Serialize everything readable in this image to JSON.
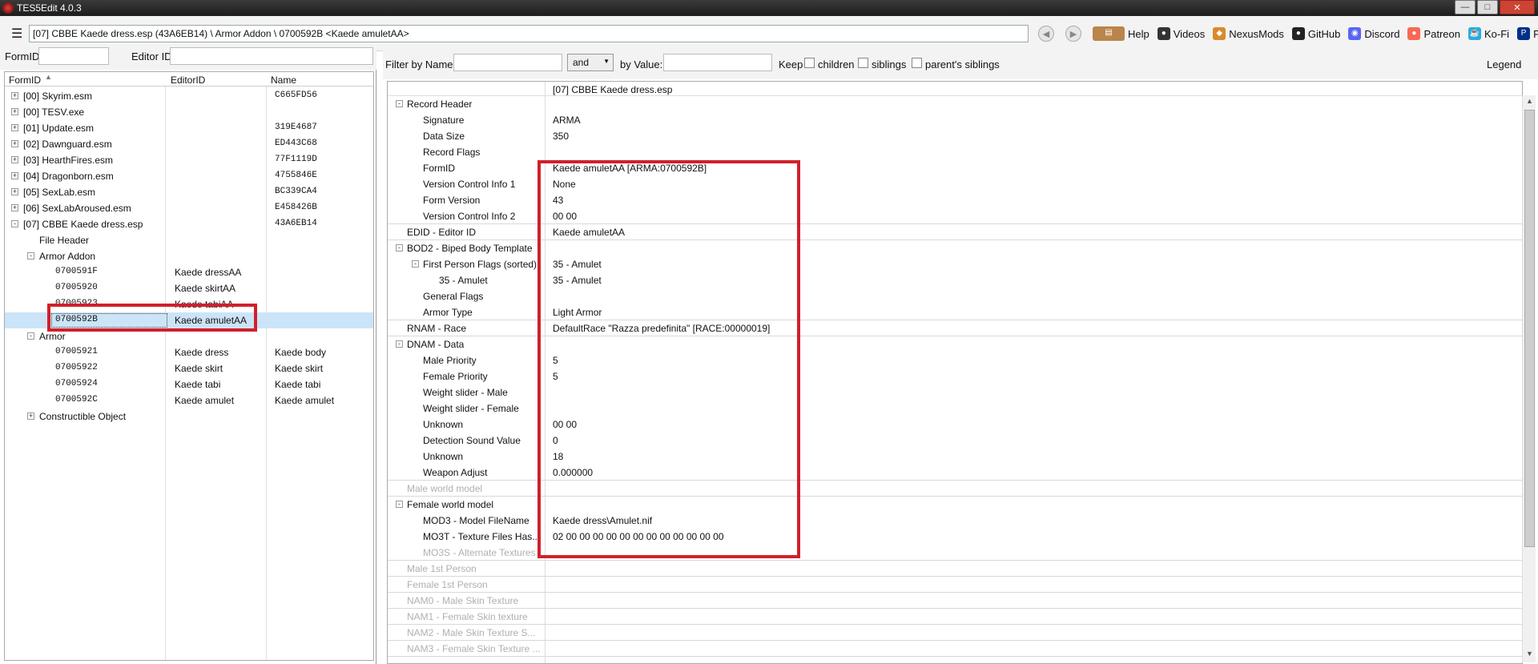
{
  "window": {
    "title": "TES5Edit 4.0.3"
  },
  "toolbar": {
    "path": "[07] CBBE Kaede dress.esp (43A6EB14) \\ Armor Addon \\ 0700592B <Kaede amuletAA>",
    "links": [
      {
        "label": "Help",
        "icon": "book-icon"
      },
      {
        "label": "Videos",
        "icon": "video-icon"
      },
      {
        "label": "NexusMods",
        "icon": "nexus-icon"
      },
      {
        "label": "GitHub",
        "icon": "github-icon"
      },
      {
        "label": "Discord",
        "icon": "discord-icon"
      },
      {
        "label": "Patreon",
        "icon": "patreon-icon"
      },
      {
        "label": "Ko-Fi",
        "icon": "kofi-icon"
      },
      {
        "label": "PayPal",
        "icon": "paypal-icon"
      }
    ]
  },
  "left": {
    "formid_label": "FormID",
    "editorid_label": "Editor ID",
    "columns": [
      "FormID",
      "EditorID",
      "Name"
    ],
    "rows": [
      {
        "label": "[00] Skyrim.esm",
        "editorid": "",
        "name": "C665FD56",
        "level": 0,
        "exp": "+"
      },
      {
        "label": "[00] TESV.exe",
        "editorid": "",
        "name": "",
        "level": 0,
        "exp": "+"
      },
      {
        "label": "[01] Update.esm",
        "editorid": "",
        "name": "319E4687",
        "level": 0,
        "exp": "+"
      },
      {
        "label": "[02] Dawnguard.esm",
        "editorid": "",
        "name": "ED443C68",
        "level": 0,
        "exp": "+"
      },
      {
        "label": "[03] HearthFires.esm",
        "editorid": "",
        "name": "77F1119D",
        "level": 0,
        "exp": "+"
      },
      {
        "label": "[04] Dragonborn.esm",
        "editorid": "",
        "name": "4755846E",
        "level": 0,
        "exp": "+"
      },
      {
        "label": "[05] SexLab.esm",
        "editorid": "",
        "name": "BC339CA4",
        "level": 0,
        "exp": "+"
      },
      {
        "label": "[06] SexLabAroused.esm",
        "editorid": "",
        "name": "E458426B",
        "level": 0,
        "exp": "+"
      },
      {
        "label": "[07] CBBE Kaede dress.esp",
        "editorid": "",
        "name": "43A6EB14",
        "level": 0,
        "exp": "-"
      },
      {
        "label": "File Header",
        "editorid": "",
        "name": "",
        "level": 1,
        "exp": ""
      },
      {
        "label": "Armor Addon",
        "editorid": "",
        "name": "",
        "level": 1,
        "exp": "-"
      },
      {
        "label": "0700591F",
        "editorid": "Kaede dressAA",
        "name": "",
        "level": 2,
        "exp": "",
        "mono": true
      },
      {
        "label": "07005920",
        "editorid": "Kaede skirtAA",
        "name": "",
        "level": 2,
        "exp": "",
        "mono": true
      },
      {
        "label": "07005923",
        "editorid": "Kaede tabiAA",
        "name": "",
        "level": 2,
        "exp": "",
        "mono": true
      },
      {
        "label": "0700592B",
        "editorid": "Kaede amuletAA",
        "name": "",
        "level": 2,
        "exp": "",
        "mono": true,
        "selected": true
      },
      {
        "label": "Armor",
        "editorid": "",
        "name": "",
        "level": 1,
        "exp": "-"
      },
      {
        "label": "07005921",
        "editorid": "Kaede dress",
        "name": "Kaede body",
        "level": 2,
        "exp": "",
        "mono": true
      },
      {
        "label": "07005922",
        "editorid": "Kaede skirt",
        "name": "Kaede skirt",
        "level": 2,
        "exp": "",
        "mono": true
      },
      {
        "label": "07005924",
        "editorid": "Kaede tabi",
        "name": "Kaede tabi",
        "level": 2,
        "exp": "",
        "mono": true
      },
      {
        "label": "0700592C",
        "editorid": "Kaede amulet",
        "name": "Kaede amulet",
        "level": 2,
        "exp": "",
        "mono": true
      },
      {
        "label": "Constructible Object",
        "editorid": "",
        "name": "",
        "level": 1,
        "exp": "+"
      }
    ]
  },
  "right": {
    "filter_name_label": "Filter by Name:",
    "op_value": "and",
    "filter_value_label": "by Value:",
    "keep_label": "Keep",
    "children_label": "children",
    "siblings_label": "siblings",
    "parents_label": "parent's siblings",
    "legend_label": "Legend",
    "column_header": "[07] CBBE Kaede dress.esp",
    "rows": [
      {
        "label": "Record Header",
        "value": "",
        "indent": 0,
        "exp": "-"
      },
      {
        "label": "Signature",
        "value": "ARMA",
        "indent": 1
      },
      {
        "label": "Data Size",
        "value": "350",
        "indent": 1
      },
      {
        "label": "Record Flags",
        "value": "",
        "indent": 1
      },
      {
        "label": "FormID",
        "value": "Kaede amuletAA [ARMA:0700592B]",
        "indent": 1
      },
      {
        "label": "Version Control Info 1",
        "value": "None",
        "indent": 1
      },
      {
        "label": "Form Version",
        "value": "43",
        "indent": 1
      },
      {
        "label": "Version Control Info 2",
        "value": "00 00",
        "indent": 1,
        "sep": true
      },
      {
        "label": "EDID - Editor ID",
        "value": "Kaede amuletAA",
        "indent": 0,
        "sep": true
      },
      {
        "label": "BOD2 - Biped Body Template",
        "value": "",
        "indent": 0,
        "exp": "-"
      },
      {
        "label": "First Person Flags (sorted)",
        "value": "35 - Amulet",
        "indent": 1,
        "exp": "-"
      },
      {
        "label": "35 - Amulet",
        "value": "35 - Amulet",
        "indent": 2
      },
      {
        "label": "General Flags",
        "value": "",
        "indent": 1
      },
      {
        "label": "Armor Type",
        "value": "Light Armor",
        "indent": 1,
        "sep": true
      },
      {
        "label": "RNAM - Race",
        "value": "DefaultRace \"Razza predefinita\" [RACE:00000019]",
        "indent": 0,
        "sep": true
      },
      {
        "label": "DNAM - Data",
        "value": "",
        "indent": 0,
        "exp": "-"
      },
      {
        "label": "Male Priority",
        "value": "5",
        "indent": 1
      },
      {
        "label": "Female Priority",
        "value": "5",
        "indent": 1
      },
      {
        "label": "Weight slider - Male",
        "value": "",
        "indent": 1
      },
      {
        "label": "Weight slider - Female",
        "value": "",
        "indent": 1
      },
      {
        "label": "Unknown",
        "value": "00 00",
        "indent": 1
      },
      {
        "label": "Detection Sound Value",
        "value": "0",
        "indent": 1
      },
      {
        "label": "Unknown",
        "value": "18",
        "indent": 1
      },
      {
        "label": "Weapon Adjust",
        "value": "0.000000",
        "indent": 1,
        "sep": true
      },
      {
        "label": "Male world model",
        "value": "",
        "indent": 0,
        "dim": true,
        "sep": true
      },
      {
        "label": "Female world model",
        "value": "",
        "indent": 0,
        "exp": "-"
      },
      {
        "label": "MOD3 - Model FileName",
        "value": "Kaede dress\\Amulet.nif",
        "indent": 1
      },
      {
        "label": "MO3T - Texture Files Has...",
        "value": "02 00 00 00 00 00 00 00 00 00 00 00 00",
        "indent": 1
      },
      {
        "label": "MO3S - Alternate Textures",
        "value": "",
        "indent": 1,
        "dim": true,
        "sep": true
      },
      {
        "label": "Male 1st Person",
        "value": "",
        "indent": 0,
        "dim": true,
        "sep": true
      },
      {
        "label": "Female 1st Person",
        "value": "",
        "indent": 0,
        "dim": true,
        "sep": true
      },
      {
        "label": "NAM0 - Male Skin Texture",
        "value": "",
        "indent": 0,
        "dim": true,
        "sep": true
      },
      {
        "label": "NAM1 - Female Skin texture",
        "value": "",
        "indent": 0,
        "dim": true,
        "sep": true
      },
      {
        "label": "NAM2 - Male Skin Texture S...",
        "value": "",
        "indent": 0,
        "dim": true,
        "sep": true
      },
      {
        "label": "NAM3 - Female Skin Texture ...",
        "value": "",
        "indent": 0,
        "dim": true,
        "sep": true
      }
    ]
  },
  "colors": {
    "highlight": "#d0202c",
    "selection": "#cce4f7"
  }
}
